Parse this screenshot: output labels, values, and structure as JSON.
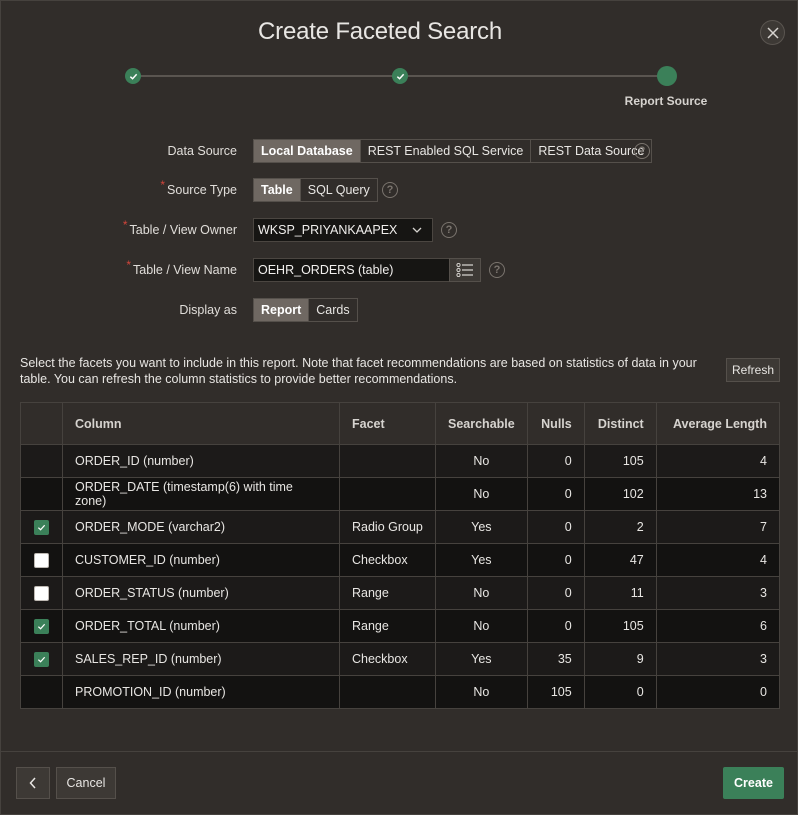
{
  "dialog": {
    "title": "Create Faceted Search",
    "close_icon": "close-icon"
  },
  "wizard": {
    "steps": [
      {
        "status": "complete",
        "label": ""
      },
      {
        "status": "complete",
        "label": ""
      },
      {
        "status": "current",
        "label": "Report Source"
      }
    ]
  },
  "form": {
    "data_source": {
      "label": "Data Source",
      "options": [
        "Local Database",
        "REST Enabled SQL Service",
        "REST Data Source"
      ],
      "selected": "Local Database"
    },
    "source_type": {
      "label": "Source Type",
      "required": true,
      "options": [
        "Table",
        "SQL Query"
      ],
      "selected": "Table"
    },
    "owner": {
      "label": "Table / View Owner",
      "required": true,
      "value": "WKSP_PRIYANKAAPEX"
    },
    "table_name": {
      "label": "Table / View Name",
      "required": true,
      "value": "OEHR_ORDERS (table)"
    },
    "display_as": {
      "label": "Display as",
      "options": [
        "Report",
        "Cards"
      ],
      "selected": "Report"
    },
    "required_marker": "*",
    "help_glyph": "?"
  },
  "facets": {
    "hint": "Select the facets you want to include in this report. Note that facet recommendations are based on statistics of data in your table. You can refresh the column statistics to provide better recommendations.",
    "refresh_label": "Refresh",
    "columns": [
      "",
      "Column",
      "Facet",
      "Searchable",
      "Nulls",
      "Distinct",
      "Average Length"
    ],
    "rows": [
      {
        "checkbox": "none",
        "column": "ORDER_ID (number)",
        "facet": "",
        "searchable": "No",
        "nulls": "0",
        "distinct": "105",
        "avg_length": "4"
      },
      {
        "checkbox": "none",
        "column": "ORDER_DATE (timestamp(6) with time zone)",
        "facet": "",
        "searchable": "No",
        "nulls": "0",
        "distinct": "102",
        "avg_length": "13"
      },
      {
        "checkbox": "checked",
        "column": "ORDER_MODE (varchar2)",
        "facet": "Radio Group",
        "searchable": "Yes",
        "nulls": "0",
        "distinct": "2",
        "avg_length": "7"
      },
      {
        "checkbox": "unchecked",
        "column": "CUSTOMER_ID (number)",
        "facet": "Checkbox",
        "searchable": "Yes",
        "nulls": "0",
        "distinct": "47",
        "avg_length": "4"
      },
      {
        "checkbox": "unchecked",
        "column": "ORDER_STATUS (number)",
        "facet": "Range",
        "searchable": "No",
        "nulls": "0",
        "distinct": "11",
        "avg_length": "3"
      },
      {
        "checkbox": "checked",
        "column": "ORDER_TOTAL (number)",
        "facet": "Range",
        "searchable": "No",
        "nulls": "0",
        "distinct": "105",
        "avg_length": "6"
      },
      {
        "checkbox": "checked",
        "column": "SALES_REP_ID (number)",
        "facet": "Checkbox",
        "searchable": "Yes",
        "nulls": "35",
        "distinct": "9",
        "avg_length": "3"
      },
      {
        "checkbox": "none",
        "column": "PROMOTION_ID (number)",
        "facet": "",
        "searchable": "No",
        "nulls": "105",
        "distinct": "0",
        "avg_length": "0"
      }
    ]
  },
  "footer": {
    "back_icon": "chevron-left-icon",
    "cancel_label": "Cancel",
    "create_label": "Create"
  },
  "colors": {
    "accent": "#3b8059",
    "background": "#312d2a",
    "required": "#d2453b"
  }
}
